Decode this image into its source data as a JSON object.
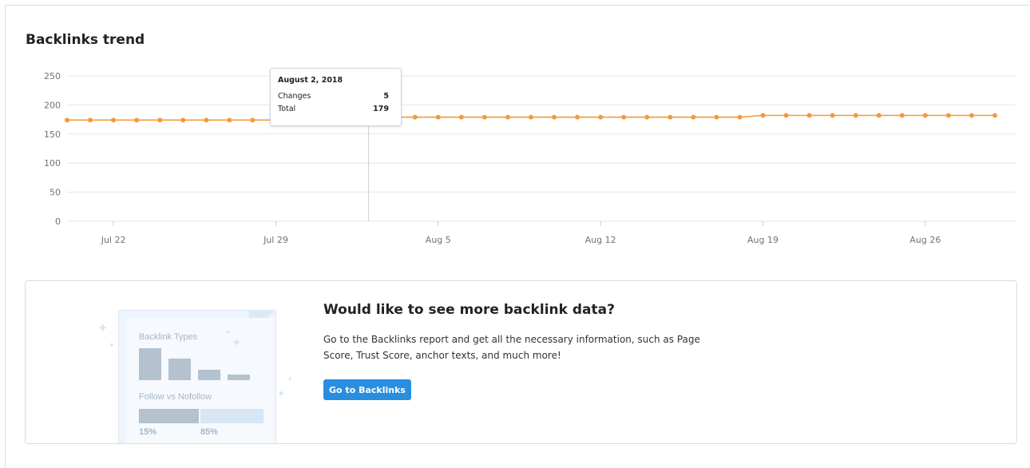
{
  "header": {
    "title": "Backlinks trend"
  },
  "chart_data": {
    "type": "line",
    "title": "Backlinks trend",
    "ylim": [
      0,
      250
    ],
    "yticks": [
      0,
      50,
      100,
      150,
      200,
      250
    ],
    "xtick_labels": [
      "Jul 22",
      "Jul 29",
      "Aug 5",
      "Aug 12",
      "Aug 19",
      "Aug 26"
    ],
    "grid": true,
    "series": [
      {
        "color": "#f39a3b",
        "x": [
          "Jul 20",
          "Jul 21",
          "Jul 22",
          "Jul 23",
          "Jul 24",
          "Jul 25",
          "Jul 26",
          "Jul 27",
          "Jul 28",
          "Jul 29",
          "Jul 30",
          "Jul 31",
          "Aug 1",
          "Aug 2",
          "Aug 3",
          "Aug 4",
          "Aug 5",
          "Aug 6",
          "Aug 7",
          "Aug 8",
          "Aug 9",
          "Aug 10",
          "Aug 11",
          "Aug 12",
          "Aug 13",
          "Aug 14",
          "Aug 15",
          "Aug 16",
          "Aug 17",
          "Aug 18",
          "Aug 19",
          "Aug 20",
          "Aug 21",
          "Aug 22",
          "Aug 23",
          "Aug 24",
          "Aug 25",
          "Aug 26",
          "Aug 27",
          "Aug 28",
          "Aug 29"
        ],
        "values": [
          174,
          174,
          174,
          174,
          174,
          174,
          174,
          174,
          174,
          174,
          174,
          174,
          174,
          179,
          179,
          179,
          179,
          179,
          179,
          179,
          179,
          179,
          179,
          179,
          179,
          179,
          179,
          179,
          179,
          179,
          182,
          182,
          182,
          182,
          182,
          182,
          182,
          182,
          182,
          182,
          182
        ]
      }
    ]
  },
  "tooltip": {
    "date": "August 2, 2018",
    "rows": [
      {
        "label": "Changes",
        "value": "5"
      },
      {
        "label": "Total",
        "value": "179"
      }
    ]
  },
  "promo": {
    "title": "Would like to see more backlink data?",
    "text": "Go to the Backlinks report and get all the necessary information, such as Page Score, Trust Score, anchor texts, and much more!",
    "button_label": "Go to Backlinks",
    "illustration": {
      "types_label": "Backlink Types",
      "follow_label": "Follow vs Nofollow",
      "follow_pct": "15%",
      "nofollow_pct": "85%",
      "follow_fraction": 0.15
    }
  }
}
